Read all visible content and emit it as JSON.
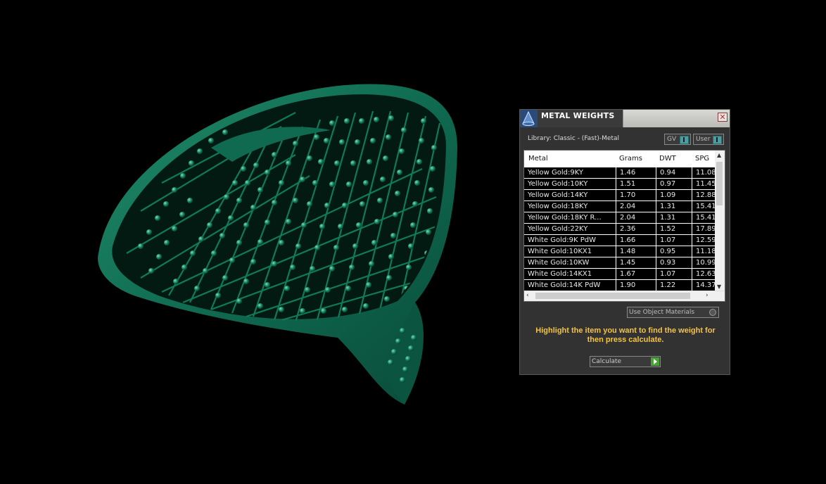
{
  "panel": {
    "title": "METAL WEIGHTS",
    "library_label": "Library: Classic - (Fast)-Metal",
    "toggle_gv": "GV",
    "toggle_user": "User",
    "use_object_materials": "Use Object Materials",
    "hint": "Highlight the item you want to find the weight for then press calculate.",
    "calculate_label": "Calculate"
  },
  "table": {
    "headers": [
      "Metal",
      "Grams",
      "DWT",
      "SPG"
    ],
    "rows": [
      [
        "Yellow Gold:9KY",
        "1.46",
        "0.94",
        "11.08"
      ],
      [
        "Yellow Gold:10KY",
        "1.51",
        "0.97",
        "11.45"
      ],
      [
        "Yellow Gold:14KY",
        "1.70",
        "1.09",
        "12.88"
      ],
      [
        "Yellow Gold:18KY",
        "2.04",
        "1.31",
        "15.41"
      ],
      [
        "Yellow Gold:18KY R...",
        "2.04",
        "1.31",
        "15.41"
      ],
      [
        "Yellow Gold:22KY",
        "2.36",
        "1.52",
        "17.89"
      ],
      [
        "White Gold:9K PdW",
        "1.66",
        "1.07",
        "12.59"
      ],
      [
        "White Gold:10KX1",
        "1.48",
        "0.95",
        "11.18"
      ],
      [
        "White Gold:10KW",
        "1.45",
        "0.93",
        "10.99"
      ],
      [
        "White Gold:14KX1",
        "1.67",
        "1.07",
        "12.63"
      ],
      [
        "White Gold:14K PdW",
        "1.90",
        "1.22",
        "14.37"
      ]
    ]
  },
  "colors": {
    "model_green": "#0d6b4f",
    "hint_text": "#f5c342",
    "toggle_knob": "#4a9ea1"
  },
  "icons": [
    "app-cone-icon",
    "close-icon",
    "play-icon",
    "scroll-up-icon",
    "scroll-down-icon",
    "scroll-left-icon",
    "scroll-right-icon"
  ]
}
